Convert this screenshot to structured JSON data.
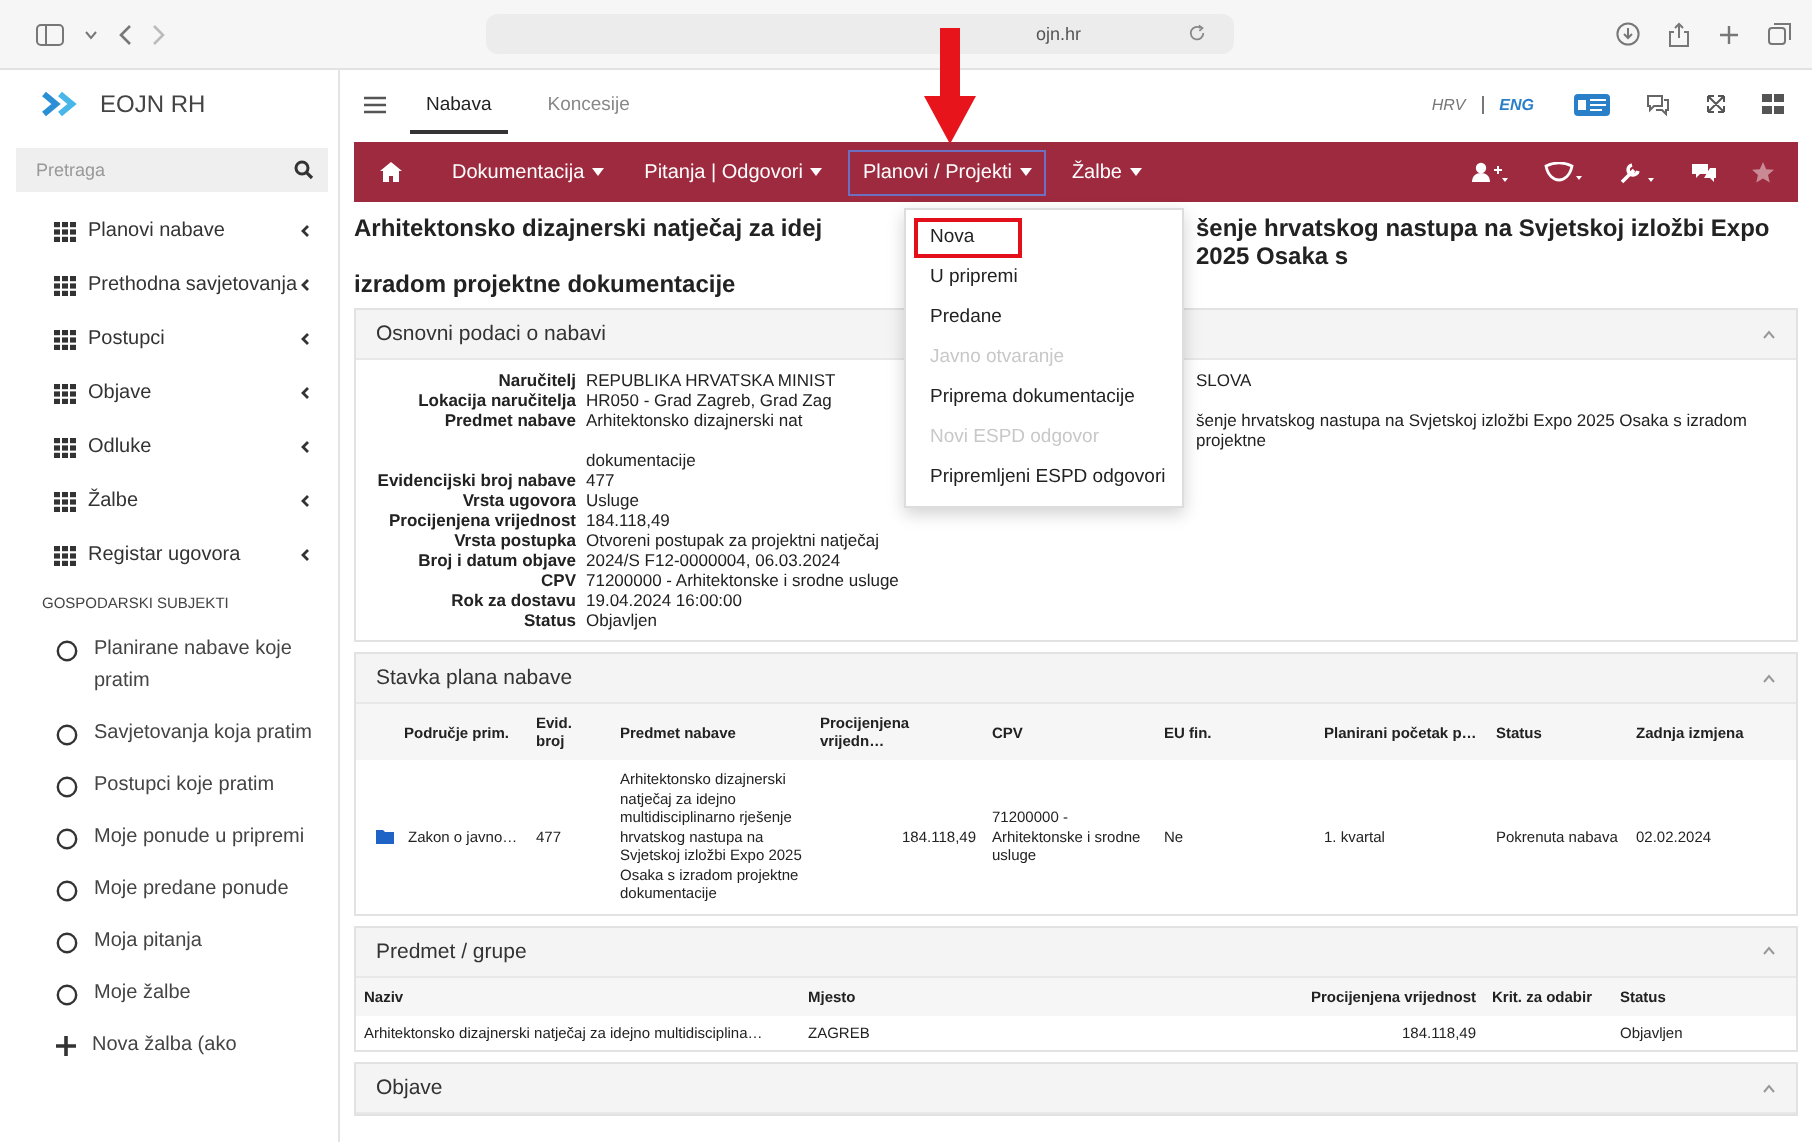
{
  "browser": {
    "url": "ojn.hr"
  },
  "app": {
    "logo": "EOJN RH"
  },
  "sidebar": {
    "search": {
      "placeholder": "Pretraga"
    },
    "items": [
      {
        "label": "Planovi nabave",
        "kind": "grid"
      },
      {
        "label": "Prethodna savjetovanja",
        "kind": "grid"
      },
      {
        "label": "Postupci",
        "kind": "grid"
      },
      {
        "label": "Objave",
        "kind": "grid"
      },
      {
        "label": "Odluke",
        "kind": "grid"
      },
      {
        "label": "Žalbe",
        "kind": "grid"
      },
      {
        "label": "Registar ugovora",
        "kind": "grid"
      }
    ],
    "section": "GOSPODARSKI SUBJEKTI",
    "links": [
      {
        "label": "Planirane nabave koje pratim",
        "kind": "circle"
      },
      {
        "label": "Savjetovanja koja pratim",
        "kind": "circle"
      },
      {
        "label": "Postupci koje pratim",
        "kind": "circle"
      },
      {
        "label": "Moje ponude u pripremi",
        "kind": "circle"
      },
      {
        "label": "Moje predane ponude",
        "kind": "circle"
      },
      {
        "label": "Moja pitanja",
        "kind": "circle"
      },
      {
        "label": "Moje žalbe",
        "kind": "circle"
      },
      {
        "label": "Nova žalba (ako",
        "kind": "plus"
      }
    ]
  },
  "tabs": [
    {
      "label": "Nabava",
      "selected": true
    },
    {
      "label": "Koncesije",
      "selected": false
    }
  ],
  "languages": [
    {
      "label": "HRV",
      "selected": false
    },
    {
      "label": "ENG",
      "selected": true
    }
  ],
  "nav": {
    "items": [
      {
        "label": "Dokumentacija",
        "open": false
      },
      {
        "label": "Pitanja | Odgovori",
        "open": false
      },
      {
        "label": "Planovi / Projekti",
        "open": true
      },
      {
        "label": "Žalbe",
        "open": false
      }
    ]
  },
  "menu": {
    "items": [
      {
        "label": "Nova",
        "disabled": false,
        "highlighted": true
      },
      {
        "label": "U pripremi",
        "disabled": false,
        "highlighted": false
      },
      {
        "label": "Predane",
        "disabled": false,
        "highlighted": false
      },
      {
        "label": "Javno otvaranje",
        "disabled": true,
        "highlighted": false
      },
      {
        "label": "Priprema dokumentacije",
        "disabled": false,
        "highlighted": false
      },
      {
        "label": "Novi ESPD odgovor",
        "disabled": true,
        "highlighted": false
      },
      {
        "label": "Pripremljeni ESPD odgovori",
        "disabled": false,
        "highlighted": false
      }
    ]
  },
  "title": {
    "lines": [
      [
        "Arhitektonsko dizajnerski natječaj za idej",
        "šenje hrvatskog nastupa na Svjetskoj izložbi Expo 2025 Osaka s"
      ],
      [
        "izradom projektne dokumentacije"
      ]
    ]
  },
  "info_panel": {
    "title": "Osnovni podaci o nabavi",
    "fields": [
      {
        "label": "Naručitelj",
        "lines": [
          [
            "REPUBLIKA HRVATSKA MINIST",
            "SLOVA"
          ]
        ]
      },
      {
        "label": "Lokacija naručitelja",
        "lines": [
          [
            "HR050 - Grad Zagreb, Grad Zag"
          ]
        ]
      },
      {
        "label": "Predmet nabave",
        "lines": [
          [
            "Arhitektonsko dizajnerski nat",
            "šenje hrvatskog nastupa na Svjetskoj izložbi Expo 2025 Osaka s izradom projektne"
          ],
          [
            "dokumentacije"
          ]
        ]
      },
      {
        "label": "Evidencijski broj nabave",
        "lines": [
          [
            "477"
          ]
        ]
      },
      {
        "label": "Vrsta ugovora",
        "lines": [
          [
            "Usluge"
          ]
        ]
      },
      {
        "label": "Procijenjena vrijednost",
        "lines": [
          [
            "184.118,49"
          ]
        ]
      },
      {
        "label": "Vrsta postupka",
        "lines": [
          [
            "Otvoreni postupak za projektni natječaj"
          ]
        ]
      },
      {
        "label": "Broj i datum objave",
        "lines": [
          [
            "2024/S F12-0000004, 06.03.2024"
          ]
        ]
      },
      {
        "label": "CPV",
        "lines": [
          [
            "71200000 - Arhitektonske i srodne usluge"
          ]
        ]
      },
      {
        "label": "Rok za dostavu",
        "lines": [
          [
            "19.04.2024 16:00:00"
          ]
        ]
      },
      {
        "label": "Status",
        "lines": [
          [
            "Objavljen"
          ]
        ]
      }
    ]
  },
  "plan_panel": {
    "title": "Stavka plana nabave",
    "columns": [
      {
        "label": "Područje prim.",
        "kind": "folder"
      },
      {
        "label": "Evid. broj",
        "kind": "text"
      },
      {
        "label": "Predmet nabave",
        "kind": "text"
      },
      {
        "label": "Procijenjena vrijedn…",
        "kind": "number"
      },
      {
        "label": "CPV",
        "kind": "text"
      },
      {
        "label": "EU fin.",
        "kind": "text"
      },
      {
        "label": "Planirani početak p…",
        "kind": "text"
      },
      {
        "label": "Status",
        "kind": "text"
      },
      {
        "label": "Zadnja izmjena",
        "kind": "text"
      }
    ],
    "rows": [
      {
        "cells": [
          "Zakon o javno…",
          "477",
          "Arhitektonsko dizajnerski natječaj za idejno multidisciplinarno rješenje hrvatskog nastupa na Svjetskoj izložbi Expo 2025 Osaka s izradom projektne dokumentacije",
          "184.118,49",
          "71200000 - Arhitektonske i srodne usluge",
          "Ne",
          "1. kvartal",
          "Pokrenuta nabava",
          "02.02.2024"
        ]
      }
    ]
  },
  "groups_panel": {
    "title": "Predmet / grupe",
    "columns": [
      {
        "label": "Naziv",
        "kind": "text"
      },
      {
        "label": "Mjesto",
        "kind": "text"
      },
      {
        "label": "Procijenjena vrijednost",
        "kind": "number"
      },
      {
        "label": "Krit. za odabir",
        "kind": "text"
      },
      {
        "label": "Status",
        "kind": "text"
      }
    ],
    "rows": [
      {
        "cells": [
          "Arhitektonsko dizajnerski natječaj za idejno multidisciplina…",
          "ZAGREB",
          "184.118,49",
          null,
          "Objavljen"
        ]
      }
    ]
  },
  "publications_panel": {
    "title": "Objave"
  }
}
